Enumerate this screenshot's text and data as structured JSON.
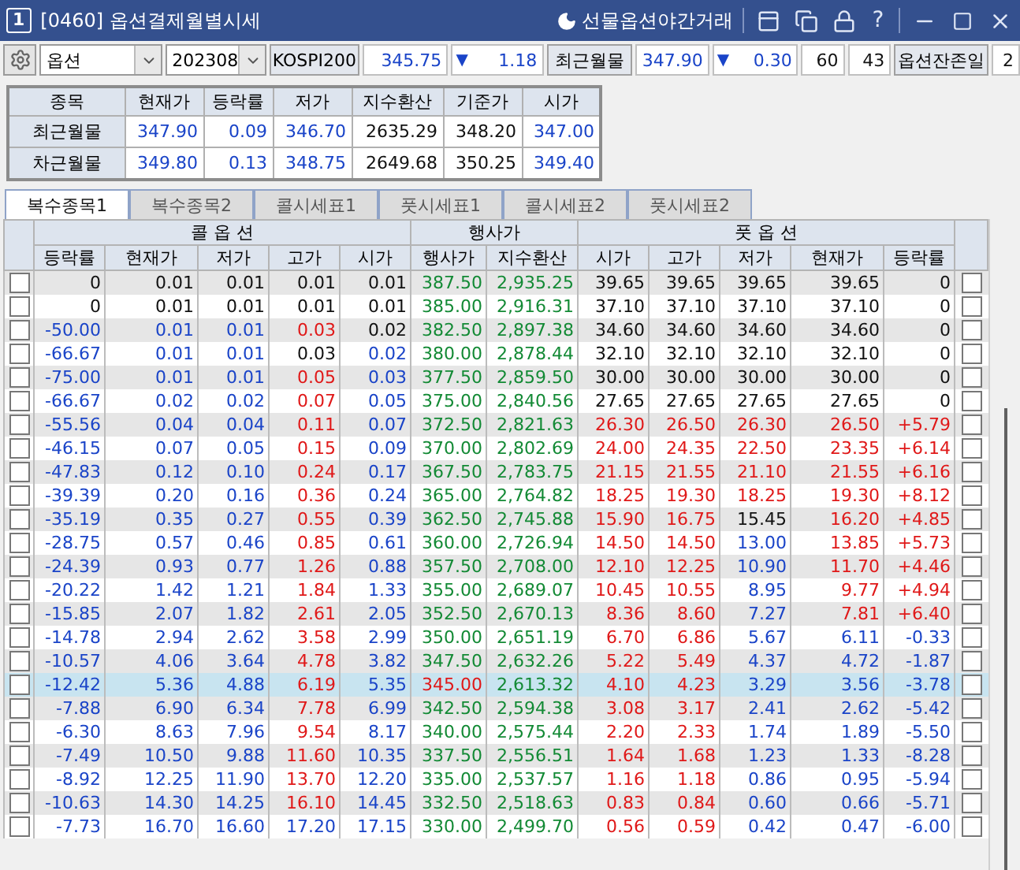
{
  "window": {
    "number": "1",
    "title": "[0460] 옵션결제월별시세",
    "night_link": "선물옵션야간거래",
    "help": "?"
  },
  "toolbar": {
    "product": "옵션",
    "month": "202308",
    "index_label": "KOSPI200",
    "index_value": "345.75",
    "index_arrow": "▼",
    "index_change": "1.18",
    "near_label": "최근월물",
    "near_value": "347.90",
    "near_arrow": "▼",
    "near_change": "0.30",
    "count_1": "60",
    "count_2": "43",
    "days_label": "옵션잔존일",
    "days_value": "2"
  },
  "summary": {
    "columns": [
      "종목",
      "현재가",
      "등락률",
      "저가",
      "지수환산",
      "기준가",
      "시가"
    ],
    "rows": [
      {
        "cells": [
          {
            "text": "최근월물"
          },
          {
            "text": "347.90",
            "color": "#1a44c8"
          },
          {
            "text": "0.09",
            "color": "#1a44c8"
          },
          {
            "text": "346.70",
            "color": "#1a44c8"
          },
          {
            "text": "2635.29",
            "color": "#111111"
          },
          {
            "text": "348.20",
            "color": "#111111"
          },
          {
            "text": "347.00",
            "color": "#1a44c8"
          }
        ]
      },
      {
        "cells": [
          {
            "text": "차근월물"
          },
          {
            "text": "349.80",
            "color": "#1a44c8"
          },
          {
            "text": "0.13",
            "color": "#1a44c8"
          },
          {
            "text": "348.75",
            "color": "#1a44c8"
          },
          {
            "text": "2649.68",
            "color": "#111111"
          },
          {
            "text": "350.25",
            "color": "#111111"
          },
          {
            "text": "349.40",
            "color": "#1a44c8"
          }
        ]
      }
    ]
  },
  "tabs": [
    {
      "label": "복수종목1",
      "selected": true
    },
    {
      "label": "복수종목2",
      "selected": false
    },
    {
      "label": "콜시세표1",
      "selected": false
    },
    {
      "label": "풋시세표1",
      "selected": false
    },
    {
      "label": "콜시세표2",
      "selected": false
    },
    {
      "label": "풋시세표2",
      "selected": false
    }
  ],
  "table": {
    "groups": [
      "콜 옵 션",
      "행사가",
      "풋 옵 션"
    ],
    "columns": [
      "등락률",
      "현재가",
      "저가",
      "고가",
      "시가",
      "행사가",
      "지수환산",
      "시가",
      "고가",
      "저가",
      "현재가",
      "등락률"
    ],
    "rows": [
      {
        "cells": [
          {
            "text": "0",
            "color": "#111111"
          },
          {
            "text": "0.01",
            "color": "#111111"
          },
          {
            "text": "0.01",
            "color": "#111111"
          },
          {
            "text": "0.01",
            "color": "#111111"
          },
          {
            "text": "0.01",
            "color": "#111111"
          },
          {
            "text": "387.50",
            "color": "#138a35"
          },
          {
            "text": "2,935.25",
            "color": "#138a35"
          },
          {
            "text": "39.65",
            "color": "#111111"
          },
          {
            "text": "39.65",
            "color": "#111111"
          },
          {
            "text": "39.65",
            "color": "#111111"
          },
          {
            "text": "39.65",
            "color": "#111111"
          },
          {
            "text": "0",
            "color": "#111111"
          }
        ],
        "selected": false,
        "call_checked": false,
        "put_checked": false
      },
      {
        "cells": [
          {
            "text": "0",
            "color": "#111111"
          },
          {
            "text": "0.01",
            "color": "#111111"
          },
          {
            "text": "0.01",
            "color": "#111111"
          },
          {
            "text": "0.01",
            "color": "#111111"
          },
          {
            "text": "0.01",
            "color": "#111111"
          },
          {
            "text": "385.00",
            "color": "#138a35"
          },
          {
            "text": "2,916.31",
            "color": "#138a35"
          },
          {
            "text": "37.10",
            "color": "#111111"
          },
          {
            "text": "37.10",
            "color": "#111111"
          },
          {
            "text": "37.10",
            "color": "#111111"
          },
          {
            "text": "37.10",
            "color": "#111111"
          },
          {
            "text": "0",
            "color": "#111111"
          }
        ],
        "selected": false,
        "call_checked": false,
        "put_checked": false
      },
      {
        "cells": [
          {
            "text": "-50.00",
            "color": "#1a44c8"
          },
          {
            "text": "0.01",
            "color": "#1a44c8"
          },
          {
            "text": "0.01",
            "color": "#1a44c8"
          },
          {
            "text": "0.03",
            "color": "#e01818"
          },
          {
            "text": "0.02",
            "color": "#111111"
          },
          {
            "text": "382.50",
            "color": "#138a35"
          },
          {
            "text": "2,897.38",
            "color": "#138a35"
          },
          {
            "text": "34.60",
            "color": "#111111"
          },
          {
            "text": "34.60",
            "color": "#111111"
          },
          {
            "text": "34.60",
            "color": "#111111"
          },
          {
            "text": "34.60",
            "color": "#111111"
          },
          {
            "text": "0",
            "color": "#111111"
          }
        ],
        "selected": false,
        "call_checked": false,
        "put_checked": false
      },
      {
        "cells": [
          {
            "text": "-66.67",
            "color": "#1a44c8"
          },
          {
            "text": "0.01",
            "color": "#1a44c8"
          },
          {
            "text": "0.01",
            "color": "#1a44c8"
          },
          {
            "text": "0.03",
            "color": "#111111"
          },
          {
            "text": "0.02",
            "color": "#1a44c8"
          },
          {
            "text": "380.00",
            "color": "#138a35"
          },
          {
            "text": "2,878.44",
            "color": "#138a35"
          },
          {
            "text": "32.10",
            "color": "#111111"
          },
          {
            "text": "32.10",
            "color": "#111111"
          },
          {
            "text": "32.10",
            "color": "#111111"
          },
          {
            "text": "32.10",
            "color": "#111111"
          },
          {
            "text": "0",
            "color": "#111111"
          }
        ],
        "selected": false,
        "call_checked": false,
        "put_checked": false
      },
      {
        "cells": [
          {
            "text": "-75.00",
            "color": "#1a44c8"
          },
          {
            "text": "0.01",
            "color": "#1a44c8"
          },
          {
            "text": "0.01",
            "color": "#1a44c8"
          },
          {
            "text": "0.05",
            "color": "#e01818"
          },
          {
            "text": "0.03",
            "color": "#1a44c8"
          },
          {
            "text": "377.50",
            "color": "#138a35"
          },
          {
            "text": "2,859.50",
            "color": "#138a35"
          },
          {
            "text": "30.00",
            "color": "#111111"
          },
          {
            "text": "30.00",
            "color": "#111111"
          },
          {
            "text": "30.00",
            "color": "#111111"
          },
          {
            "text": "30.00",
            "color": "#111111"
          },
          {
            "text": "0",
            "color": "#111111"
          }
        ],
        "selected": false,
        "call_checked": false,
        "put_checked": false
      },
      {
        "cells": [
          {
            "text": "-66.67",
            "color": "#1a44c8"
          },
          {
            "text": "0.02",
            "color": "#1a44c8"
          },
          {
            "text": "0.02",
            "color": "#1a44c8"
          },
          {
            "text": "0.07",
            "color": "#e01818"
          },
          {
            "text": "0.05",
            "color": "#1a44c8"
          },
          {
            "text": "375.00",
            "color": "#138a35"
          },
          {
            "text": "2,840.56",
            "color": "#138a35"
          },
          {
            "text": "27.65",
            "color": "#111111"
          },
          {
            "text": "27.65",
            "color": "#111111"
          },
          {
            "text": "27.65",
            "color": "#111111"
          },
          {
            "text": "27.65",
            "color": "#111111"
          },
          {
            "text": "0",
            "color": "#111111"
          }
        ],
        "selected": false,
        "call_checked": false,
        "put_checked": false
      },
      {
        "cells": [
          {
            "text": "-55.56",
            "color": "#1a44c8"
          },
          {
            "text": "0.04",
            "color": "#1a44c8"
          },
          {
            "text": "0.04",
            "color": "#1a44c8"
          },
          {
            "text": "0.11",
            "color": "#e01818"
          },
          {
            "text": "0.07",
            "color": "#1a44c8"
          },
          {
            "text": "372.50",
            "color": "#138a35"
          },
          {
            "text": "2,821.63",
            "color": "#138a35"
          },
          {
            "text": "26.30",
            "color": "#e01818"
          },
          {
            "text": "26.50",
            "color": "#e01818"
          },
          {
            "text": "26.30",
            "color": "#e01818"
          },
          {
            "text": "26.50",
            "color": "#e01818"
          },
          {
            "text": "+5.79",
            "color": "#e01818"
          }
        ],
        "selected": false,
        "call_checked": false,
        "put_checked": false
      },
      {
        "cells": [
          {
            "text": "-46.15",
            "color": "#1a44c8"
          },
          {
            "text": "0.07",
            "color": "#1a44c8"
          },
          {
            "text": "0.05",
            "color": "#1a44c8"
          },
          {
            "text": "0.15",
            "color": "#e01818"
          },
          {
            "text": "0.09",
            "color": "#1a44c8"
          },
          {
            "text": "370.00",
            "color": "#138a35"
          },
          {
            "text": "2,802.69",
            "color": "#138a35"
          },
          {
            "text": "24.00",
            "color": "#e01818"
          },
          {
            "text": "24.35",
            "color": "#e01818"
          },
          {
            "text": "22.50",
            "color": "#e01818"
          },
          {
            "text": "23.35",
            "color": "#e01818"
          },
          {
            "text": "+6.14",
            "color": "#e01818"
          }
        ],
        "selected": false,
        "call_checked": false,
        "put_checked": false
      },
      {
        "cells": [
          {
            "text": "-47.83",
            "color": "#1a44c8"
          },
          {
            "text": "0.12",
            "color": "#1a44c8"
          },
          {
            "text": "0.10",
            "color": "#1a44c8"
          },
          {
            "text": "0.24",
            "color": "#e01818"
          },
          {
            "text": "0.17",
            "color": "#1a44c8"
          },
          {
            "text": "367.50",
            "color": "#138a35"
          },
          {
            "text": "2,783.75",
            "color": "#138a35"
          },
          {
            "text": "21.15",
            "color": "#e01818"
          },
          {
            "text": "21.55",
            "color": "#e01818"
          },
          {
            "text": "21.10",
            "color": "#e01818"
          },
          {
            "text": "21.55",
            "color": "#e01818"
          },
          {
            "text": "+6.16",
            "color": "#e01818"
          }
        ],
        "selected": false,
        "call_checked": false,
        "put_checked": false
      },
      {
        "cells": [
          {
            "text": "-39.39",
            "color": "#1a44c8"
          },
          {
            "text": "0.20",
            "color": "#1a44c8"
          },
          {
            "text": "0.16",
            "color": "#1a44c8"
          },
          {
            "text": "0.36",
            "color": "#e01818"
          },
          {
            "text": "0.24",
            "color": "#1a44c8"
          },
          {
            "text": "365.00",
            "color": "#138a35"
          },
          {
            "text": "2,764.82",
            "color": "#138a35"
          },
          {
            "text": "18.25",
            "color": "#e01818"
          },
          {
            "text": "19.30",
            "color": "#e01818"
          },
          {
            "text": "18.25",
            "color": "#e01818"
          },
          {
            "text": "19.30",
            "color": "#e01818"
          },
          {
            "text": "+8.12",
            "color": "#e01818"
          }
        ],
        "selected": false,
        "call_checked": false,
        "put_checked": false
      },
      {
        "cells": [
          {
            "text": "-35.19",
            "color": "#1a44c8"
          },
          {
            "text": "0.35",
            "color": "#1a44c8"
          },
          {
            "text": "0.27",
            "color": "#1a44c8"
          },
          {
            "text": "0.55",
            "color": "#e01818"
          },
          {
            "text": "0.39",
            "color": "#1a44c8"
          },
          {
            "text": "362.50",
            "color": "#138a35"
          },
          {
            "text": "2,745.88",
            "color": "#138a35"
          },
          {
            "text": "15.90",
            "color": "#e01818"
          },
          {
            "text": "16.75",
            "color": "#e01818"
          },
          {
            "text": "15.45",
            "color": "#111111"
          },
          {
            "text": "16.20",
            "color": "#e01818"
          },
          {
            "text": "+4.85",
            "color": "#e01818"
          }
        ],
        "selected": false,
        "call_checked": false,
        "put_checked": false
      },
      {
        "cells": [
          {
            "text": "-28.75",
            "color": "#1a44c8"
          },
          {
            "text": "0.57",
            "color": "#1a44c8"
          },
          {
            "text": "0.46",
            "color": "#1a44c8"
          },
          {
            "text": "0.85",
            "color": "#e01818"
          },
          {
            "text": "0.61",
            "color": "#1a44c8"
          },
          {
            "text": "360.00",
            "color": "#138a35"
          },
          {
            "text": "2,726.94",
            "color": "#138a35"
          },
          {
            "text": "14.50",
            "color": "#e01818"
          },
          {
            "text": "14.50",
            "color": "#e01818"
          },
          {
            "text": "13.00",
            "color": "#1a44c8"
          },
          {
            "text": "13.85",
            "color": "#e01818"
          },
          {
            "text": "+5.73",
            "color": "#e01818"
          }
        ],
        "selected": false,
        "call_checked": false,
        "put_checked": false
      },
      {
        "cells": [
          {
            "text": "-24.39",
            "color": "#1a44c8"
          },
          {
            "text": "0.93",
            "color": "#1a44c8"
          },
          {
            "text": "0.77",
            "color": "#1a44c8"
          },
          {
            "text": "1.26",
            "color": "#e01818"
          },
          {
            "text": "0.88",
            "color": "#1a44c8"
          },
          {
            "text": "357.50",
            "color": "#138a35"
          },
          {
            "text": "2,708.00",
            "color": "#138a35"
          },
          {
            "text": "12.10",
            "color": "#e01818"
          },
          {
            "text": "12.25",
            "color": "#e01818"
          },
          {
            "text": "10.90",
            "color": "#1a44c8"
          },
          {
            "text": "11.70",
            "color": "#e01818"
          },
          {
            "text": "+4.46",
            "color": "#e01818"
          }
        ],
        "selected": false,
        "call_checked": false,
        "put_checked": false
      },
      {
        "cells": [
          {
            "text": "-20.22",
            "color": "#1a44c8"
          },
          {
            "text": "1.42",
            "color": "#1a44c8"
          },
          {
            "text": "1.21",
            "color": "#1a44c8"
          },
          {
            "text": "1.84",
            "color": "#e01818"
          },
          {
            "text": "1.33",
            "color": "#1a44c8"
          },
          {
            "text": "355.00",
            "color": "#138a35"
          },
          {
            "text": "2,689.07",
            "color": "#138a35"
          },
          {
            "text": "10.45",
            "color": "#e01818"
          },
          {
            "text": "10.55",
            "color": "#e01818"
          },
          {
            "text": "8.95",
            "color": "#1a44c8"
          },
          {
            "text": "9.77",
            "color": "#e01818"
          },
          {
            "text": "+4.94",
            "color": "#e01818"
          }
        ],
        "selected": false,
        "call_checked": false,
        "put_checked": false
      },
      {
        "cells": [
          {
            "text": "-15.85",
            "color": "#1a44c8"
          },
          {
            "text": "2.07",
            "color": "#1a44c8"
          },
          {
            "text": "1.82",
            "color": "#1a44c8"
          },
          {
            "text": "2.61",
            "color": "#e01818"
          },
          {
            "text": "2.05",
            "color": "#1a44c8"
          },
          {
            "text": "352.50",
            "color": "#138a35"
          },
          {
            "text": "2,670.13",
            "color": "#138a35"
          },
          {
            "text": "8.36",
            "color": "#e01818"
          },
          {
            "text": "8.60",
            "color": "#e01818"
          },
          {
            "text": "7.27",
            "color": "#1a44c8"
          },
          {
            "text": "7.81",
            "color": "#e01818"
          },
          {
            "text": "+6.40",
            "color": "#e01818"
          }
        ],
        "selected": false,
        "call_checked": false,
        "put_checked": false
      },
      {
        "cells": [
          {
            "text": "-14.78",
            "color": "#1a44c8"
          },
          {
            "text": "2.94",
            "color": "#1a44c8"
          },
          {
            "text": "2.62",
            "color": "#1a44c8"
          },
          {
            "text": "3.58",
            "color": "#e01818"
          },
          {
            "text": "2.99",
            "color": "#1a44c8"
          },
          {
            "text": "350.00",
            "color": "#138a35"
          },
          {
            "text": "2,651.19",
            "color": "#138a35"
          },
          {
            "text": "6.70",
            "color": "#e01818"
          },
          {
            "text": "6.86",
            "color": "#e01818"
          },
          {
            "text": "5.67",
            "color": "#1a44c8"
          },
          {
            "text": "6.11",
            "color": "#1a44c8"
          },
          {
            "text": "-0.33",
            "color": "#1a44c8"
          }
        ],
        "selected": false,
        "call_checked": false,
        "put_checked": false
      },
      {
        "cells": [
          {
            "text": "-10.57",
            "color": "#1a44c8"
          },
          {
            "text": "4.06",
            "color": "#1a44c8"
          },
          {
            "text": "3.64",
            "color": "#1a44c8"
          },
          {
            "text": "4.78",
            "color": "#e01818"
          },
          {
            "text": "3.82",
            "color": "#1a44c8"
          },
          {
            "text": "347.50",
            "color": "#138a35"
          },
          {
            "text": "2,632.26",
            "color": "#138a35"
          },
          {
            "text": "5.22",
            "color": "#e01818"
          },
          {
            "text": "5.49",
            "color": "#e01818"
          },
          {
            "text": "4.37",
            "color": "#1a44c8"
          },
          {
            "text": "4.72",
            "color": "#1a44c8"
          },
          {
            "text": "-1.87",
            "color": "#1a44c8"
          }
        ],
        "selected": false,
        "call_checked": false,
        "put_checked": false
      },
      {
        "cells": [
          {
            "text": "-12.42",
            "color": "#1a44c8"
          },
          {
            "text": "5.36",
            "color": "#1a44c8"
          },
          {
            "text": "4.88",
            "color": "#1a44c8"
          },
          {
            "text": "6.19",
            "color": "#e01818"
          },
          {
            "text": "5.35",
            "color": "#1a44c8"
          },
          {
            "text": "345.00",
            "color": "#e01818"
          },
          {
            "text": "2,613.32",
            "color": "#138a35"
          },
          {
            "text": "4.10",
            "color": "#e01818"
          },
          {
            "text": "4.23",
            "color": "#e01818"
          },
          {
            "text": "3.29",
            "color": "#1a44c8"
          },
          {
            "text": "3.56",
            "color": "#1a44c8"
          },
          {
            "text": "-3.78",
            "color": "#1a44c8"
          }
        ],
        "selected": true,
        "call_checked": false,
        "put_checked": false
      },
      {
        "cells": [
          {
            "text": "-7.88",
            "color": "#1a44c8"
          },
          {
            "text": "6.90",
            "color": "#1a44c8"
          },
          {
            "text": "6.34",
            "color": "#1a44c8"
          },
          {
            "text": "7.78",
            "color": "#e01818"
          },
          {
            "text": "6.99",
            "color": "#1a44c8"
          },
          {
            "text": "342.50",
            "color": "#138a35"
          },
          {
            "text": "2,594.38",
            "color": "#138a35"
          },
          {
            "text": "3.08",
            "color": "#e01818"
          },
          {
            "text": "3.17",
            "color": "#e01818"
          },
          {
            "text": "2.41",
            "color": "#1a44c8"
          },
          {
            "text": "2.62",
            "color": "#1a44c8"
          },
          {
            "text": "-5.42",
            "color": "#1a44c8"
          }
        ],
        "selected": false,
        "call_checked": false,
        "put_checked": false
      },
      {
        "cells": [
          {
            "text": "-6.30",
            "color": "#1a44c8"
          },
          {
            "text": "8.63",
            "color": "#1a44c8"
          },
          {
            "text": "7.96",
            "color": "#1a44c8"
          },
          {
            "text": "9.54",
            "color": "#e01818"
          },
          {
            "text": "8.17",
            "color": "#1a44c8"
          },
          {
            "text": "340.00",
            "color": "#138a35"
          },
          {
            "text": "2,575.44",
            "color": "#138a35"
          },
          {
            "text": "2.20",
            "color": "#e01818"
          },
          {
            "text": "2.33",
            "color": "#e01818"
          },
          {
            "text": "1.74",
            "color": "#1a44c8"
          },
          {
            "text": "1.89",
            "color": "#1a44c8"
          },
          {
            "text": "-5.50",
            "color": "#1a44c8"
          }
        ],
        "selected": false,
        "call_checked": false,
        "put_checked": false
      },
      {
        "cells": [
          {
            "text": "-7.49",
            "color": "#1a44c8"
          },
          {
            "text": "10.50",
            "color": "#1a44c8"
          },
          {
            "text": "9.88",
            "color": "#1a44c8"
          },
          {
            "text": "11.60",
            "color": "#e01818"
          },
          {
            "text": "10.35",
            "color": "#1a44c8"
          },
          {
            "text": "337.50",
            "color": "#138a35"
          },
          {
            "text": "2,556.51",
            "color": "#138a35"
          },
          {
            "text": "1.64",
            "color": "#e01818"
          },
          {
            "text": "1.68",
            "color": "#e01818"
          },
          {
            "text": "1.23",
            "color": "#1a44c8"
          },
          {
            "text": "1.33",
            "color": "#1a44c8"
          },
          {
            "text": "-8.28",
            "color": "#1a44c8"
          }
        ],
        "selected": false,
        "call_checked": false,
        "put_checked": false
      },
      {
        "cells": [
          {
            "text": "-8.92",
            "color": "#1a44c8"
          },
          {
            "text": "12.25",
            "color": "#1a44c8"
          },
          {
            "text": "11.90",
            "color": "#1a44c8"
          },
          {
            "text": "13.70",
            "color": "#e01818"
          },
          {
            "text": "12.20",
            "color": "#1a44c8"
          },
          {
            "text": "335.00",
            "color": "#138a35"
          },
          {
            "text": "2,537.57",
            "color": "#138a35"
          },
          {
            "text": "1.16",
            "color": "#e01818"
          },
          {
            "text": "1.18",
            "color": "#e01818"
          },
          {
            "text": "0.86",
            "color": "#1a44c8"
          },
          {
            "text": "0.95",
            "color": "#1a44c8"
          },
          {
            "text": "-5.94",
            "color": "#1a44c8"
          }
        ],
        "selected": false,
        "call_checked": false,
        "put_checked": false
      },
      {
        "cells": [
          {
            "text": "-10.63",
            "color": "#1a44c8"
          },
          {
            "text": "14.30",
            "color": "#1a44c8"
          },
          {
            "text": "14.25",
            "color": "#1a44c8"
          },
          {
            "text": "16.10",
            "color": "#e01818"
          },
          {
            "text": "14.45",
            "color": "#1a44c8"
          },
          {
            "text": "332.50",
            "color": "#138a35"
          },
          {
            "text": "2,518.63",
            "color": "#138a35"
          },
          {
            "text": "0.83",
            "color": "#e01818"
          },
          {
            "text": "0.84",
            "color": "#e01818"
          },
          {
            "text": "0.60",
            "color": "#1a44c8"
          },
          {
            "text": "0.66",
            "color": "#1a44c8"
          },
          {
            "text": "-5.71",
            "color": "#1a44c8"
          }
        ],
        "selected": false,
        "call_checked": false,
        "put_checked": false
      },
      {
        "cells": [
          {
            "text": "-7.73",
            "color": "#1a44c8"
          },
          {
            "text": "16.70",
            "color": "#1a44c8"
          },
          {
            "text": "16.60",
            "color": "#1a44c8"
          },
          {
            "text": "17.20",
            "color": "#1a44c8"
          },
          {
            "text": "17.15",
            "color": "#1a44c8"
          },
          {
            "text": "330.00",
            "color": "#138a35"
          },
          {
            "text": "2,499.70",
            "color": "#138a35"
          },
          {
            "text": "0.56",
            "color": "#e01818"
          },
          {
            "text": "0.59",
            "color": "#e01818"
          },
          {
            "text": "0.42",
            "color": "#1a44c8"
          },
          {
            "text": "0.47",
            "color": "#1a44c8"
          },
          {
            "text": "-6.00",
            "color": "#1a44c8"
          }
        ],
        "selected": false,
        "call_checked": false,
        "put_checked": false
      }
    ]
  }
}
